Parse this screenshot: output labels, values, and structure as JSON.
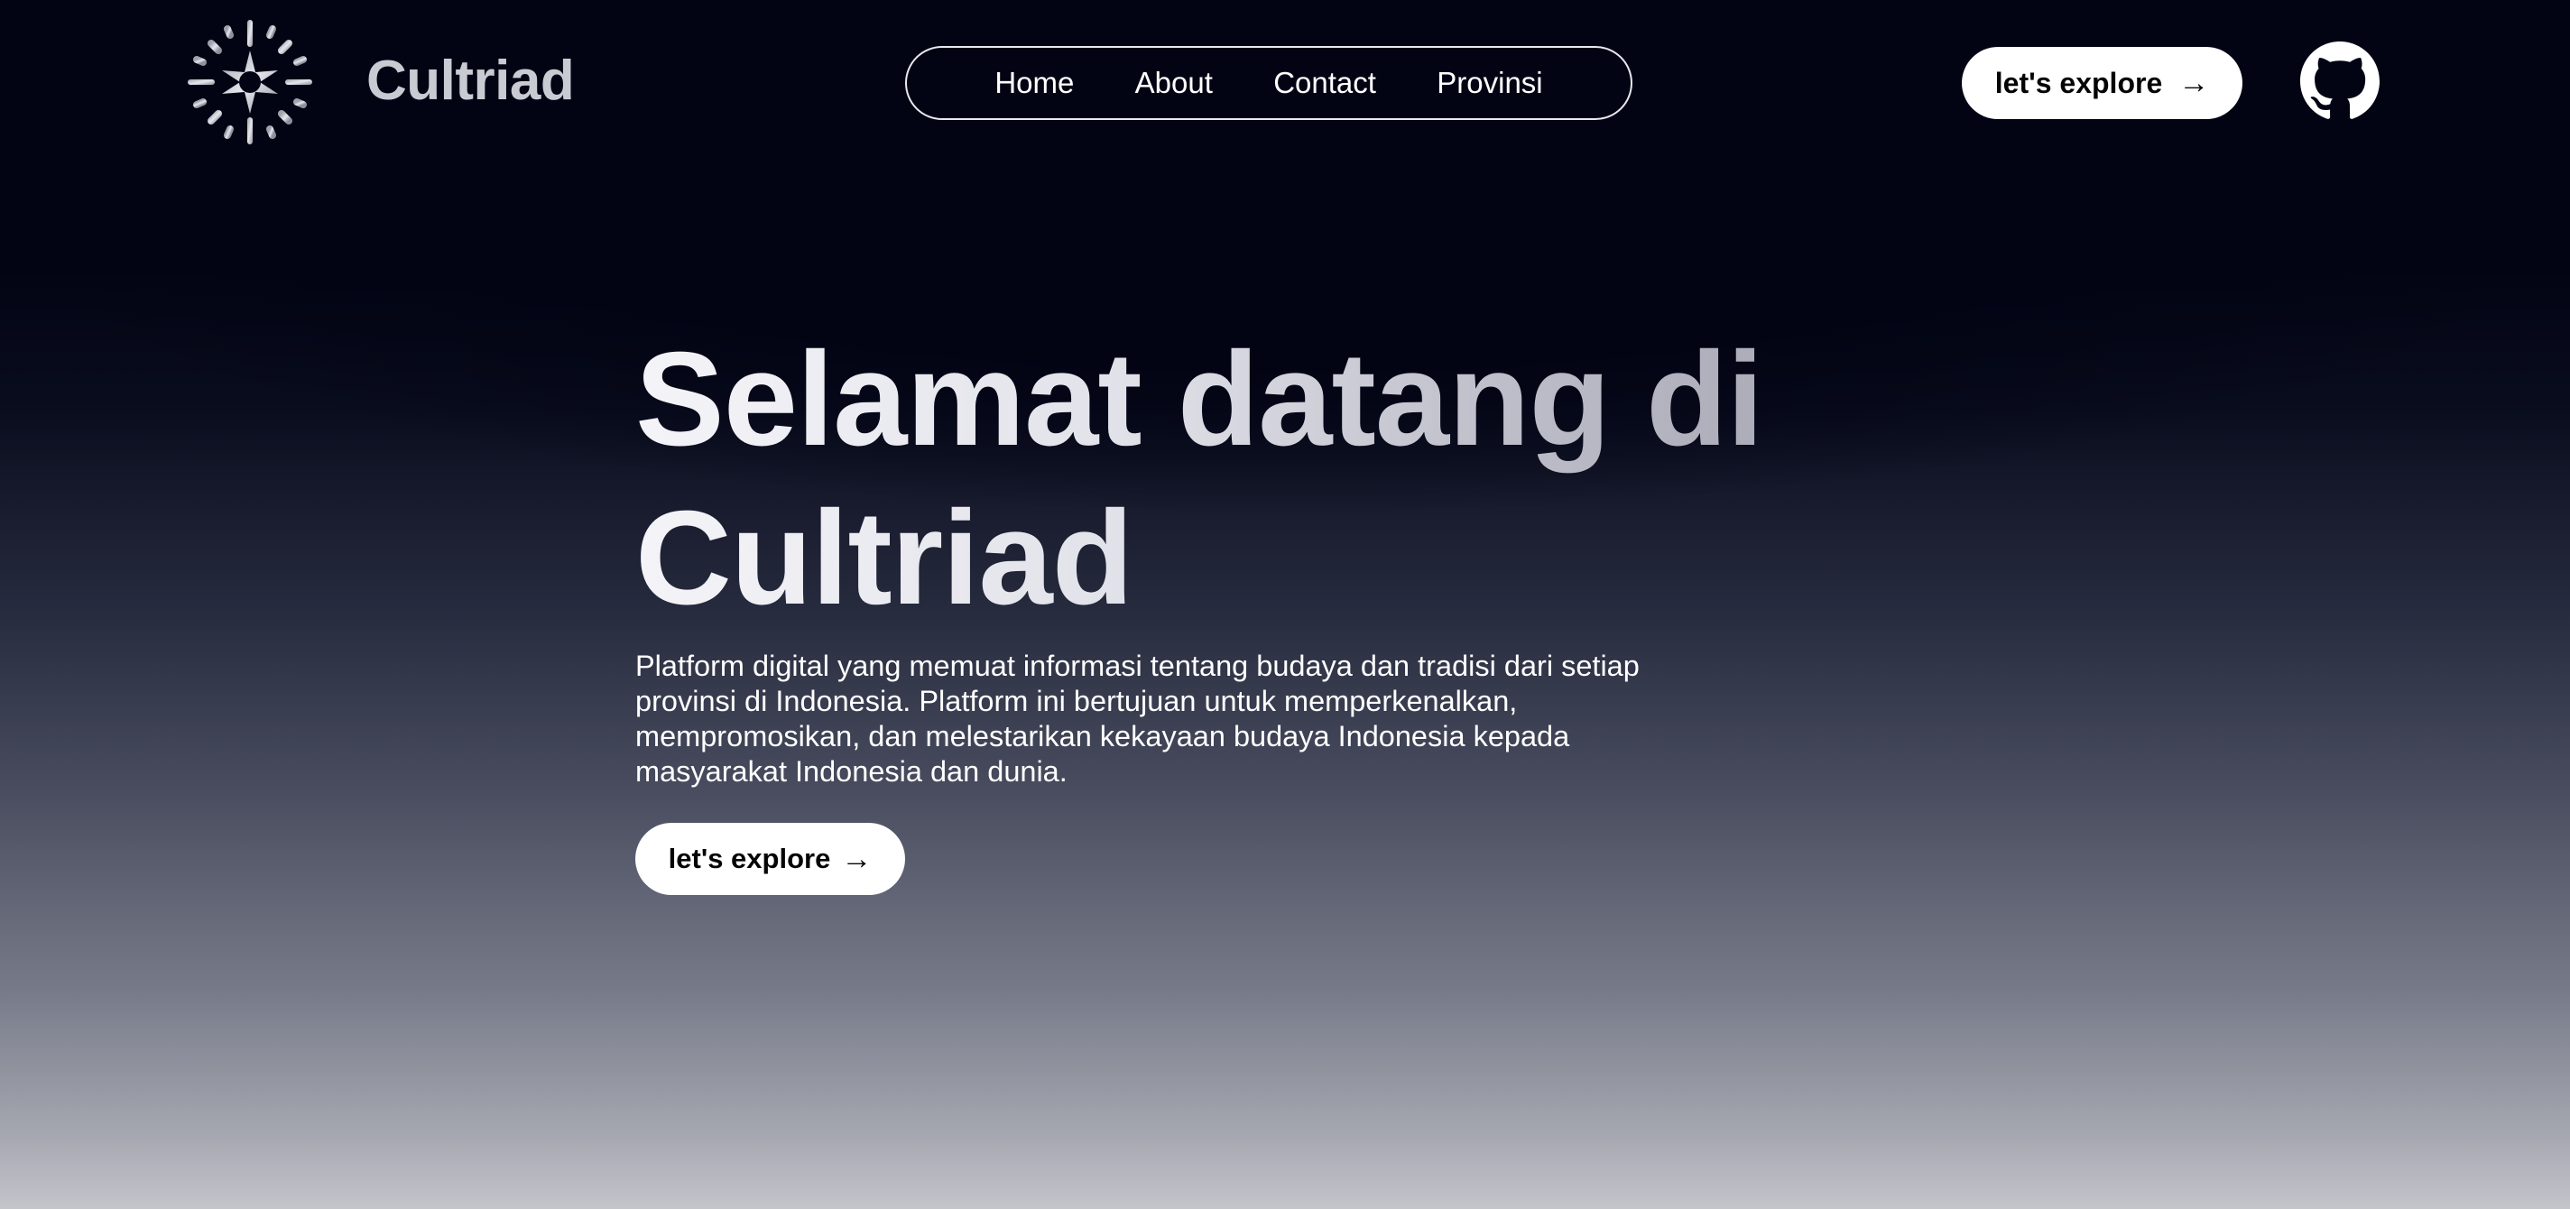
{
  "header": {
    "brand": "Cultriad",
    "logo_icon": "sun-burst-icon",
    "nav": [
      {
        "label": "Home"
      },
      {
        "label": "About"
      },
      {
        "label": "Contact"
      },
      {
        "label": "Provinsi"
      }
    ],
    "cta_label": "let's explore",
    "cta_icon": "arrow-right-icon",
    "github_icon": "github-icon"
  },
  "hero": {
    "title_line1": "Selamat datang di",
    "title_line2": "Cultriad",
    "description": "Platform digital yang memuat informasi tentang budaya dan tradisi dari setiap provinsi di Indonesia. Platform ini bertujuan untuk memperkenalkan, mempromosikan, dan melestarikan kekayaan budaya Indonesia kepada masyarakat Indonesia dan dunia.",
    "cta_label": "let's explore"
  },
  "colors": {
    "background_top": "#020414",
    "background_bottom": "#c4c5cb",
    "button_bg": "#ffffff",
    "button_text": "#050505"
  }
}
